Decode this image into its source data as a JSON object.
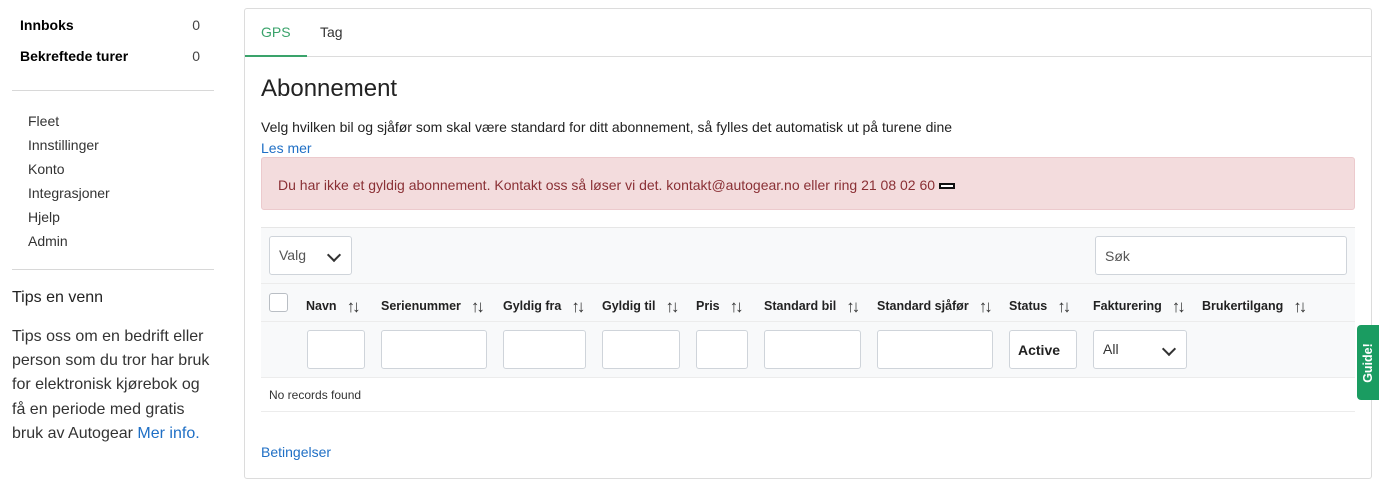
{
  "sidebar": {
    "counters": [
      {
        "label": "Innboks",
        "count": "0"
      },
      {
        "label": "Bekreftede turer",
        "count": "0"
      }
    ],
    "nav": [
      "Fleet",
      "Innstillinger",
      "Konto",
      "Integrasjoner",
      "Hjelp",
      "Admin"
    ],
    "tips": {
      "title": "Tips en venn",
      "text": "Tips oss om en bedrift eller person som du tror har bruk for elektronisk kjørebok og få en periode med gratis bruk av Autogear",
      "link": "Mer info."
    }
  },
  "tabs": [
    "GPS",
    "Tag"
  ],
  "main": {
    "title": "Abonnement",
    "description": "Velg hvilken bil og sjåfør som skal være standard for ditt abonnement, så fylles det automatisk ut på turene dine",
    "read_more": "Les mer",
    "alert": "Du har ikke et gyldig abonnement. Kontakt oss så løser vi det. kontakt@autogear.no eller ring 21 08 02 60",
    "terms_link": "Betingelser"
  },
  "table": {
    "actions_select": "Valg",
    "search_placeholder": "Søk",
    "columns": [
      "Navn",
      "Serienummer",
      "Gyldig fra",
      "Gyldig til",
      "Pris",
      "Standard bil",
      "Standard sjåfør",
      "Status",
      "Fakturering",
      "Brukertilgang"
    ],
    "status_filter_value": "Active",
    "billing_filter_value": "All",
    "empty_message": "No records found"
  },
  "guide_tab": "Guide!",
  "colors": {
    "accent_green": "#3aa36b",
    "link_blue": "#1f6fc5",
    "alert_bg": "#f3dcdd",
    "alert_text": "#8a3035",
    "guide_green": "#1a9c61"
  }
}
